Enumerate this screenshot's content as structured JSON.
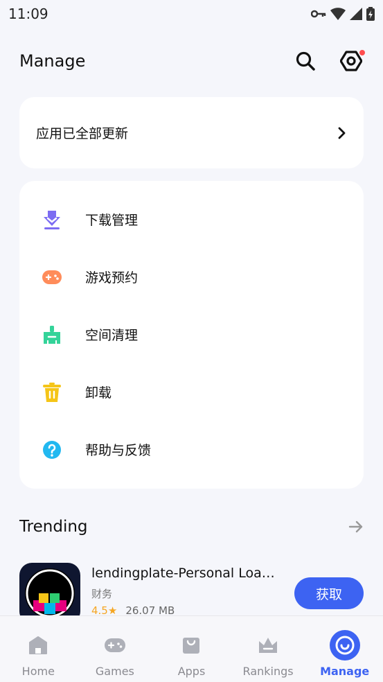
{
  "status_bar": {
    "time": "11:09"
  },
  "header": {
    "title": "Manage"
  },
  "update_card": {
    "text": "应用已全部更新"
  },
  "menu": {
    "items": [
      {
        "label": "下载管理",
        "icon": "download-icon",
        "color": "#7c6cf2"
      },
      {
        "label": "游戏预约",
        "icon": "gamepad-icon",
        "color": "#ff8c5a"
      },
      {
        "label": "空间清理",
        "icon": "broom-icon",
        "color": "#34d399"
      },
      {
        "label": "卸载",
        "icon": "trash-icon",
        "color": "#f5c518"
      },
      {
        "label": "帮助与反馈",
        "icon": "help-icon",
        "color": "#22b8f0"
      }
    ]
  },
  "trending": {
    "title": "Trending",
    "app": {
      "name": "lendingplate-Personal Loa…",
      "category": "财务",
      "rating": "4.5★",
      "size": "26.07 MB",
      "button_label": "获取"
    }
  },
  "bottom_nav": {
    "items": [
      {
        "label": "Home",
        "icon": "home-icon"
      },
      {
        "label": "Games",
        "icon": "gamepad-icon"
      },
      {
        "label": "Apps",
        "icon": "shopping-bag-icon"
      },
      {
        "label": "Rankings",
        "icon": "crown-icon"
      },
      {
        "label": "Manage",
        "icon": "manage-icon",
        "active": true
      }
    ]
  },
  "colors": {
    "accent": "#3d63f2",
    "background": "#f5f6fb"
  }
}
